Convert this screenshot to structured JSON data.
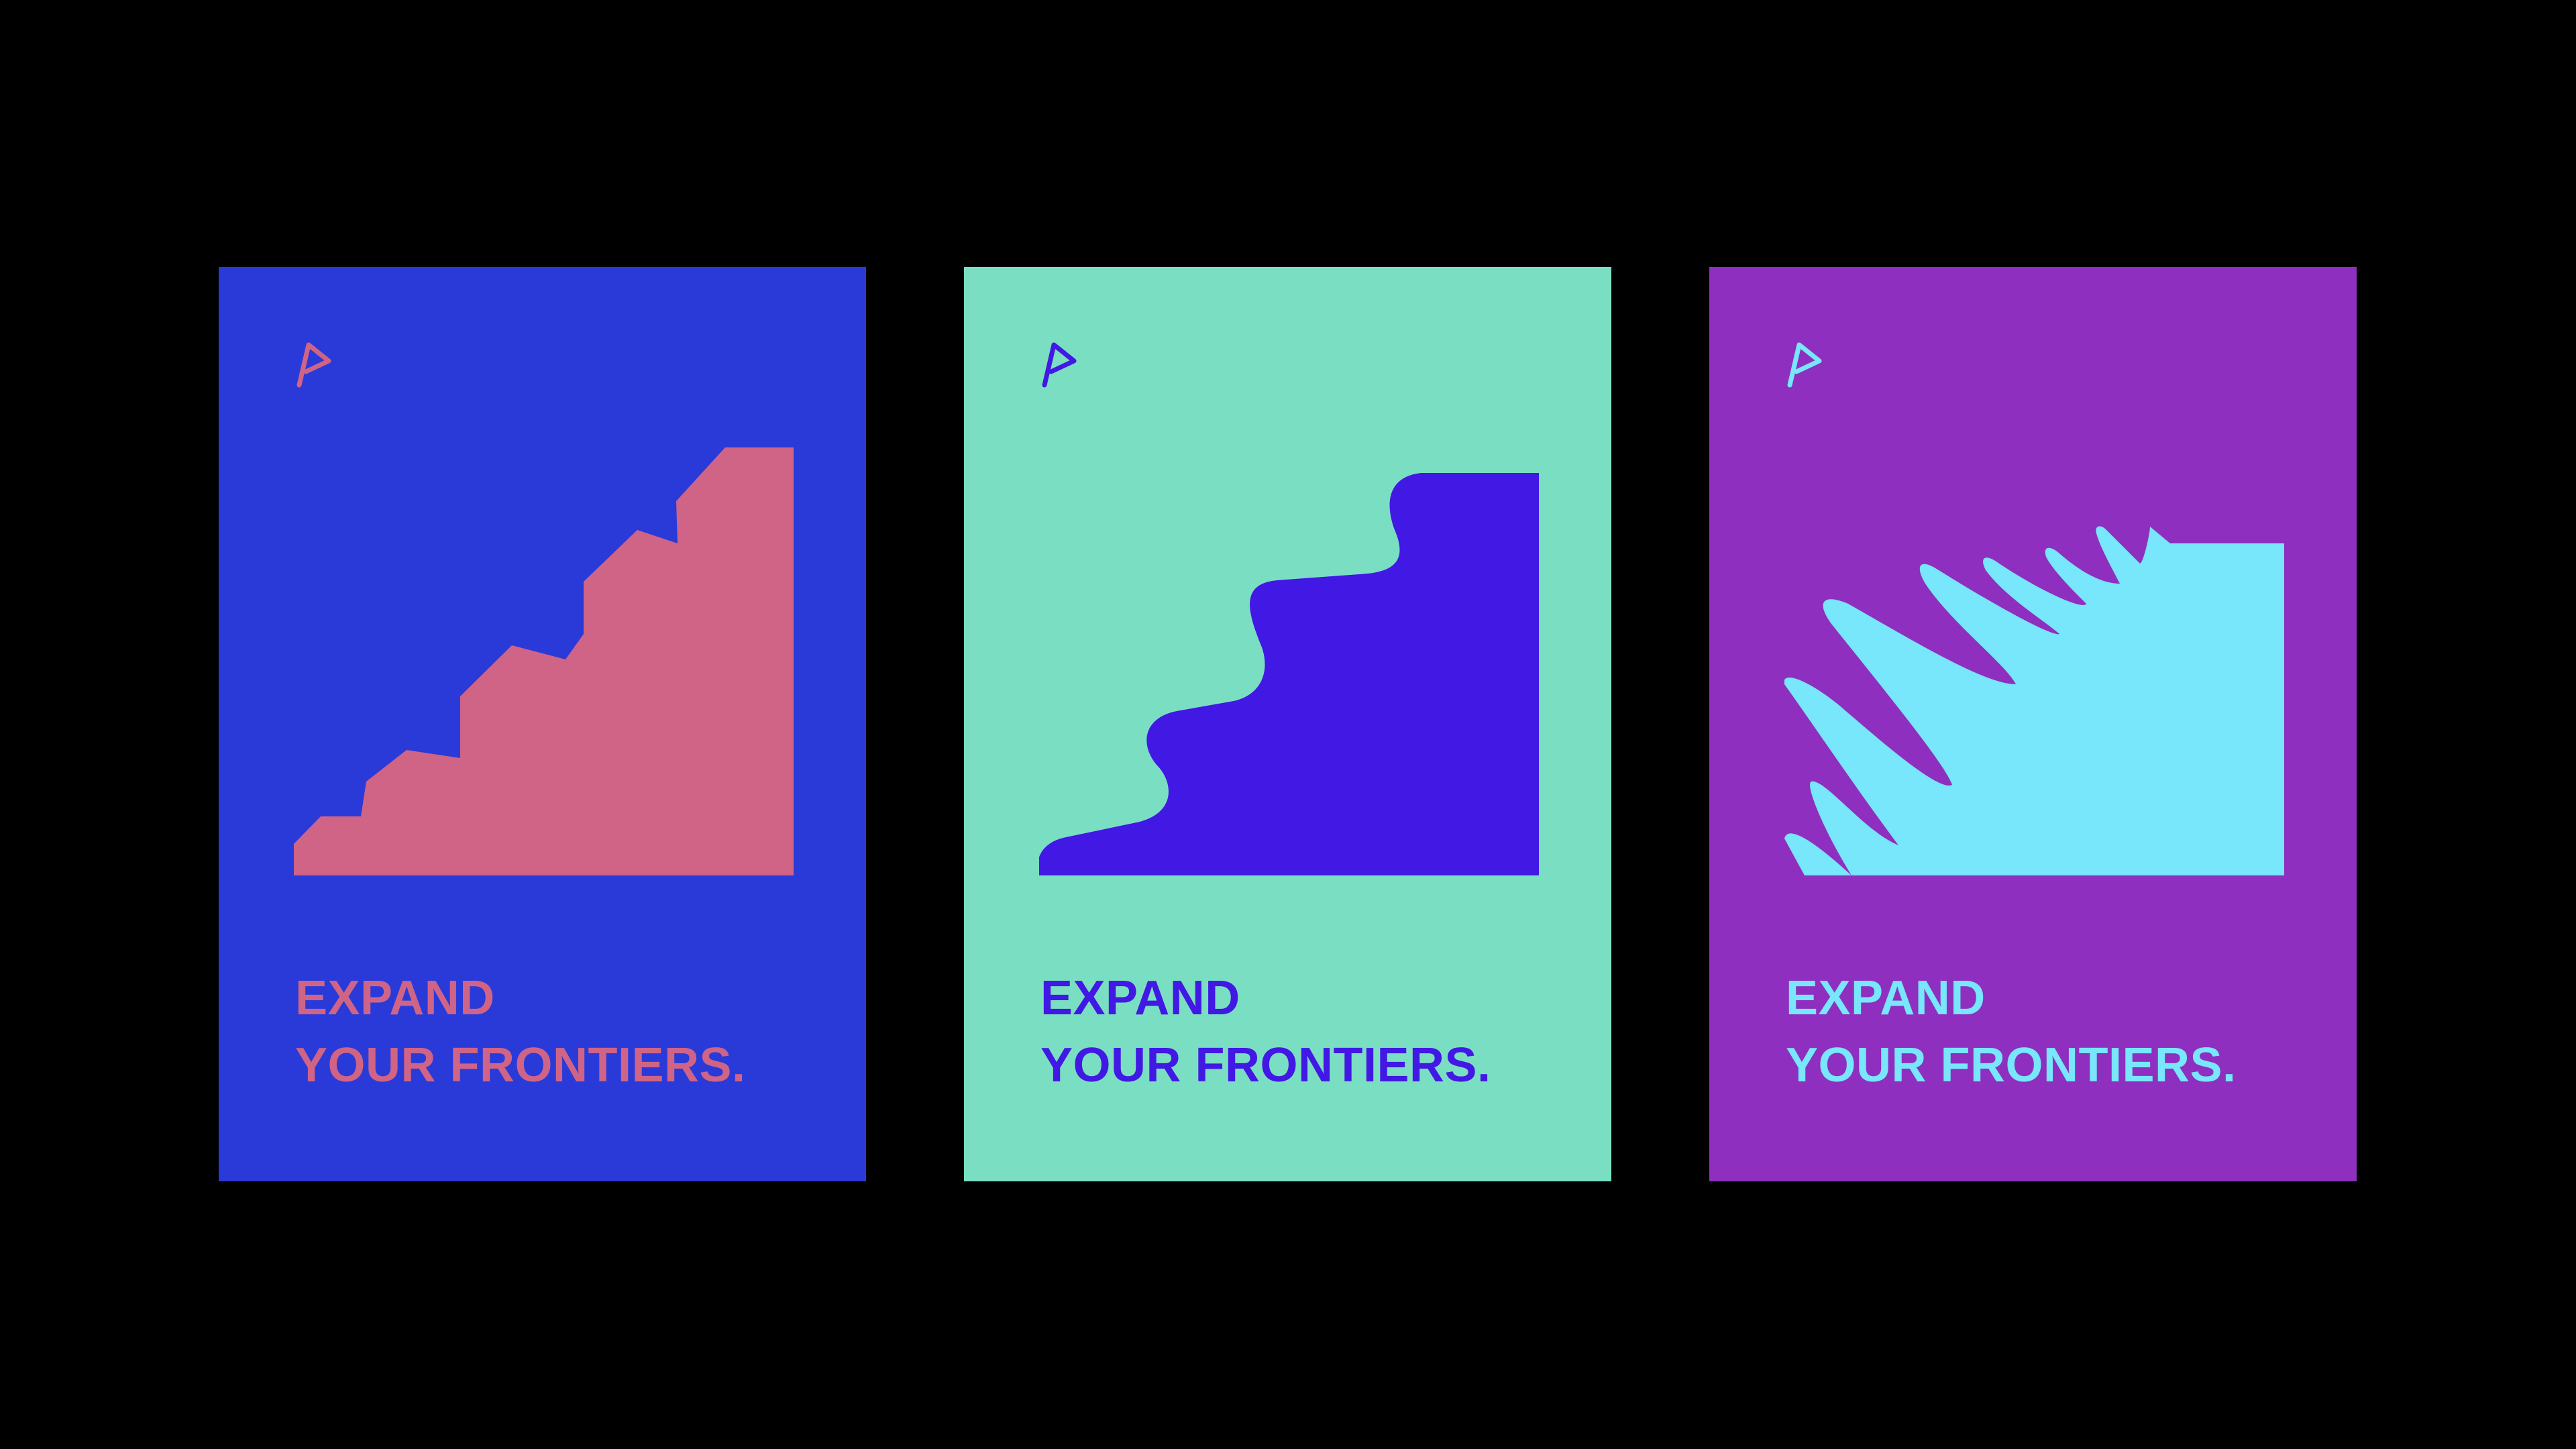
{
  "posters": [
    {
      "background": "#2a3ad8",
      "accent": "#cf6487",
      "logo_icon": "flag-icon",
      "artwork": "staircase-steps",
      "headline_line1": "EXPAND",
      "headline_line2": "YOUR FRONTIERS."
    },
    {
      "background": "#7adfc2",
      "accent": "#4218e4",
      "logo_icon": "flag-icon",
      "artwork": "wavy-steps",
      "headline_line1": "EXPAND",
      "headline_line2": "YOUR FRONTIERS."
    },
    {
      "background": "#8e2fc0",
      "accent": "#78e6fb",
      "logo_icon": "flag-icon",
      "artwork": "spiky-burst",
      "headline_line1": "EXPAND",
      "headline_line2": "YOUR FRONTIERS."
    }
  ],
  "canvas_background": "#000000"
}
